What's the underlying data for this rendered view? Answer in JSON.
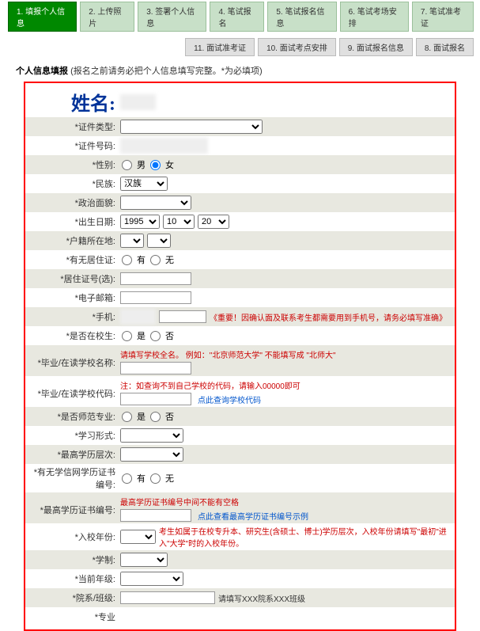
{
  "tabs1": {
    "t1": "1. 填报个人信息",
    "t2": "2. 上传照片",
    "t3": "3. 签署个人信息",
    "t4": "4. 笔试报名",
    "t5": "5. 笔试报名信息",
    "t6": "6. 笔试考场安排",
    "t7": "7. 笔试准考证"
  },
  "tabs2": {
    "t11": "11. 面试准考证",
    "t10": "10. 面试考点安排",
    "t9": "9. 面试报名信息",
    "t8": "8. 面试报名"
  },
  "section": {
    "title": "个人信息填报",
    "note": "(报名之前请务必把个人信息填写完整。*为必填项)"
  },
  "labels": {
    "name": "姓名:",
    "id_type": "*证件类型:",
    "id_no": "*证件号码:",
    "gender": "*性别:",
    "ethnicity": "*民族:",
    "political": "*政治面貌:",
    "birth": "*出生日期:",
    "hukou": "*户籍所在地:",
    "has_residence": "*有无居住证:",
    "residence_id": "*居住证号(选):",
    "email": "*电子邮箱:",
    "phone": "*手机:",
    "is_student": "*是否在校生:",
    "school_name": "*毕业/在读学校名称:",
    "school_code": "*毕业/在读学校代码:",
    "is_normal": "*是否师范专业:",
    "study_type": "*学习形式:",
    "edu_level": "*最高学历层次:",
    "has_xuexin": "*有无学信网学历证书编号:",
    "edu_cert_no": "*最高学历证书编号:",
    "enroll_year": "*入校年份:",
    "schooling": "*学制:",
    "grade": "*当前年级:",
    "dept_class": "*院系/班级:",
    "major": "*专业"
  },
  "values": {
    "ethnicity": "汉族",
    "birth_year": "1995",
    "birth_month": "10",
    "birth_day": "20"
  },
  "radio": {
    "male": "男",
    "female": "女",
    "yes": "有",
    "no": "无",
    "is": "是",
    "not": "否"
  },
  "hints": {
    "phone": "《重要！因确认面及联系考生都需要用到手机号，请务必填写准确》",
    "school_name1": "请填写学校全名。  例如：\"北京师范大学\" 不能填写成 \"北师大\"",
    "school_code1": "注：如查询不到自己学校的代码，请输入00000即可",
    "school_code_link": "点此查询学校代码",
    "edu_cert_no1": "最高学历证书编号中间不能有空格",
    "edu_cert_link": "点此查看最高学历证书编号示例",
    "enroll_year": "考生如属于在校专升本、研究生(含硕士、博士)学历层次，入校年份请填写\"最初\"进入\"大学\"时的入校年份。",
    "dept_class": "请填写XXX院系XXX班级"
  }
}
